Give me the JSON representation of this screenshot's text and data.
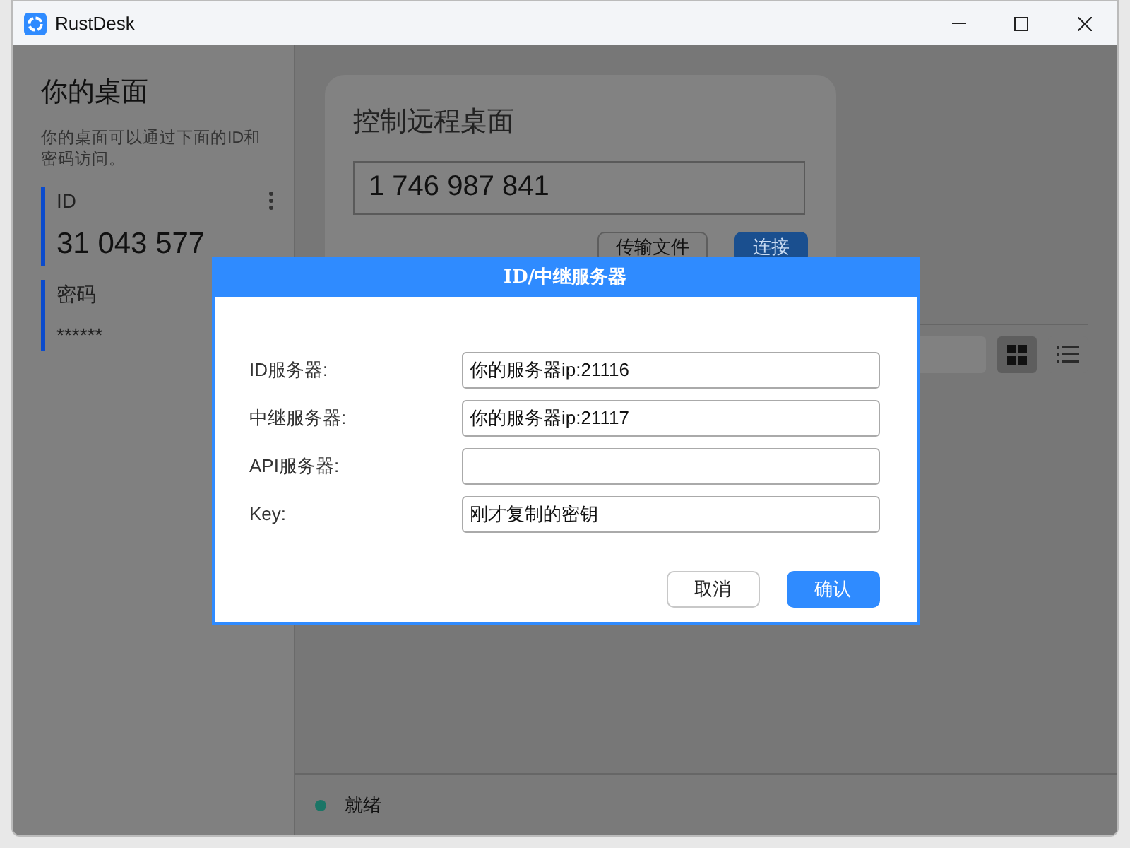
{
  "window": {
    "title": "RustDesk"
  },
  "sidebar": {
    "heading": "你的桌面",
    "description": "你的桌面可以通过下面的ID和密码访问。",
    "id_label": "ID",
    "id_value": "31 043 577",
    "password_label": "密码",
    "password_value": "******"
  },
  "remote_card": {
    "heading": "控制远程桌面",
    "id_input": "1 746 987 841",
    "buttons": [
      {
        "label": "传输文件",
        "kind": "outline"
      },
      {
        "label": "连接",
        "kind": "primary"
      }
    ]
  },
  "view_toggle": [
    {
      "kind": "grid",
      "selected": true
    },
    {
      "kind": "list",
      "selected": false
    }
  ],
  "status_bar": {
    "text": "就绪",
    "color": "#1b7566"
  },
  "dialog": {
    "title": "ID/中继服务器",
    "fields": [
      {
        "label": "ID服务器:",
        "value": "你的服务器ip:21116"
      },
      {
        "label": "中继服务器:",
        "value": "你的服务器ip:21117"
      },
      {
        "label": "API服务器:"
      },
      {
        "label": "Key:",
        "value": "刚才复制的密钥"
      }
    ],
    "buttons": [
      {
        "label": "取消",
        "kind": "outline"
      },
      {
        "label": "确认",
        "kind": "primary"
      }
    ]
  }
}
